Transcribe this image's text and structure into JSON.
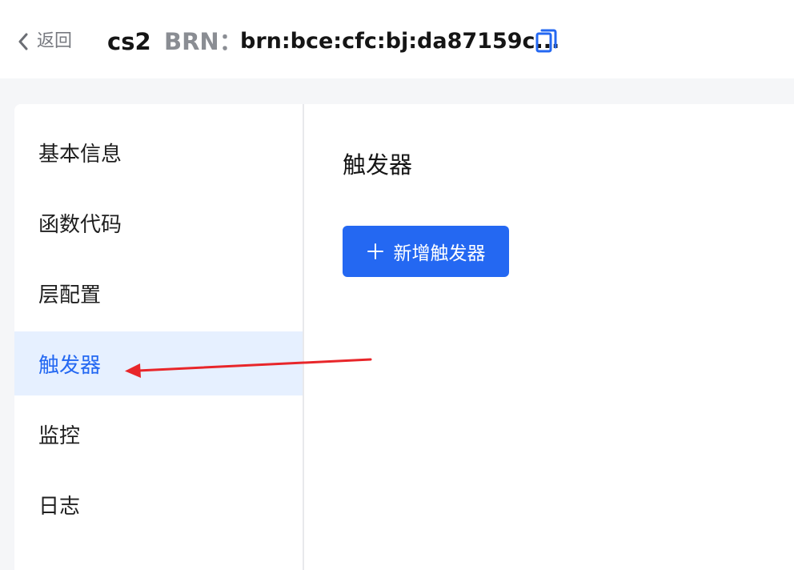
{
  "header": {
    "back_label": "返回",
    "function_name": "cs2",
    "brn_label": "BRN：",
    "brn_value": "brn:bce:cfc:bj:da87159c..."
  },
  "sidebar": {
    "items": [
      {
        "label": "基本信息",
        "active": false
      },
      {
        "label": "函数代码",
        "active": false
      },
      {
        "label": "层配置",
        "active": false
      },
      {
        "label": "触发器",
        "active": true
      },
      {
        "label": "监控",
        "active": false
      },
      {
        "label": "日志",
        "active": false
      }
    ]
  },
  "main": {
    "title": "触发器",
    "add_button_label": "新增触发器"
  },
  "colors": {
    "accent": "#2468f2",
    "active_bg": "#e6f0ff",
    "annotation_arrow": "#e8262a"
  },
  "icons": {
    "back": "chevron-left-icon",
    "copy": "copy-icon",
    "plus": "plus-icon"
  }
}
